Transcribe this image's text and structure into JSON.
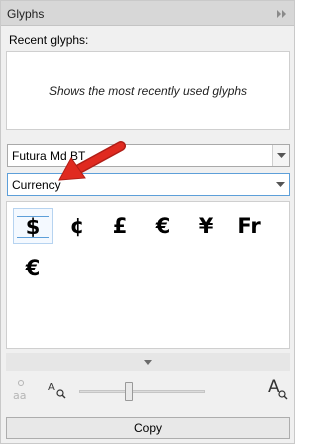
{
  "panel": {
    "title": "Glyphs",
    "collapse_icon": "double-chevron-right-icon"
  },
  "recent": {
    "label": "Recent glyphs:",
    "placeholder": "Shows the most recently used glyphs"
  },
  "font_select": {
    "value": "Futura Md BT"
  },
  "subset_select": {
    "value": "Currency"
  },
  "glyphs": [
    "$",
    "¢",
    "£",
    "€",
    "¥",
    "Fr",
    "€"
  ],
  "zoom": {
    "level": 0.4
  },
  "actions": {
    "copy_label": "Copy"
  },
  "colors": {
    "accent": "#5d9fd9",
    "annotation_arrow": "#e02a20"
  }
}
